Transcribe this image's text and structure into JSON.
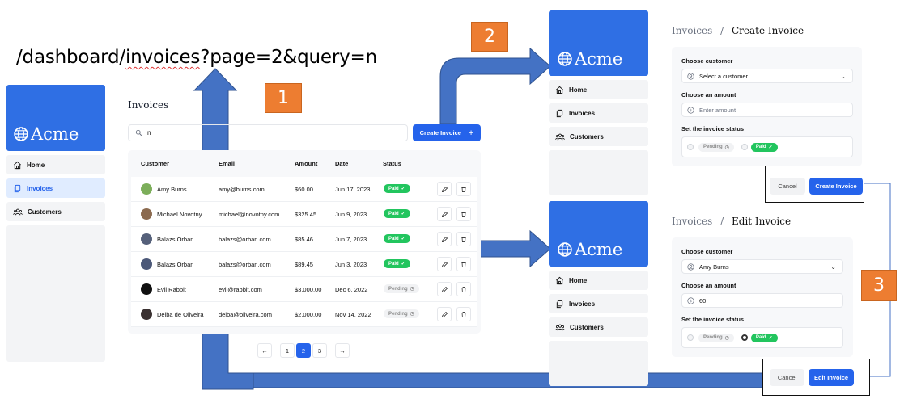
{
  "url_text": {
    "prefix": "/dashboard/",
    "underlined": "invoices",
    "suffix": "?page=2&query=n"
  },
  "annotations": {
    "n1": "1",
    "n2": "2",
    "n3": "3"
  },
  "brand": "Acme",
  "nav": {
    "home": "Home",
    "invoices": "Invoices",
    "customers": "Customers"
  },
  "list": {
    "title": "Invoices",
    "search_value": "n",
    "create_label": "Create Invoice",
    "headers": {
      "customer": "Customer",
      "email": "Email",
      "amount": "Amount",
      "date": "Date",
      "status": "Status"
    },
    "rows": [
      {
        "name": "Amy Burns",
        "email": "amy@burns.com",
        "amount": "$60.00",
        "date": "Jun 17, 2023",
        "status": "Paid"
      },
      {
        "name": "Michael Novotny",
        "email": "michael@novotny.com",
        "amount": "$325.45",
        "date": "Jun 9, 2023",
        "status": "Paid"
      },
      {
        "name": "Balazs Orban",
        "email": "balazs@orban.com",
        "amount": "$85.46",
        "date": "Jun 7, 2023",
        "status": "Paid"
      },
      {
        "name": "Balazs Orban",
        "email": "balazs@orban.com",
        "amount": "$89.45",
        "date": "Jun 3, 2023",
        "status": "Paid"
      },
      {
        "name": "Evil Rabbit",
        "email": "evil@rabbit.com",
        "amount": "$3,000.00",
        "date": "Dec 6, 2022",
        "status": "Pending"
      },
      {
        "name": "Delba de Oliveira",
        "email": "delba@oliveira.com",
        "amount": "$2,000.00",
        "date": "Nov 14, 2022",
        "status": "Pending"
      }
    ],
    "pages": [
      "1",
      "2",
      "3"
    ],
    "current_page": "2"
  },
  "create_form": {
    "bc_parent": "Invoices",
    "bc_sep": "/",
    "bc_current": "Create Invoice",
    "customer_label": "Choose customer",
    "customer_placeholder": "Select a customer",
    "amount_label": "Choose an amount",
    "amount_placeholder": "Enter amount",
    "status_label": "Set the invoice status",
    "pending": "Pending",
    "paid": "Paid",
    "cancel": "Cancel",
    "submit": "Create Invoice"
  },
  "edit_form": {
    "bc_parent": "Invoices",
    "bc_sep": "/",
    "bc_current": "Edit Invoice",
    "customer_label": "Choose customer",
    "customer_value": "Amy Burns",
    "amount_label": "Choose an amount",
    "amount_value": "60",
    "status_label": "Set the invoice status",
    "pending": "Pending",
    "paid": "Paid",
    "cancel": "Cancel",
    "submit": "Edit Invoice"
  },
  "colors": {
    "accent": "#2563eb",
    "logo_bg": "#2f6fe4",
    "paid": "#22c55e",
    "arrow": "#4472c4",
    "annotation": "#ed7d31"
  }
}
